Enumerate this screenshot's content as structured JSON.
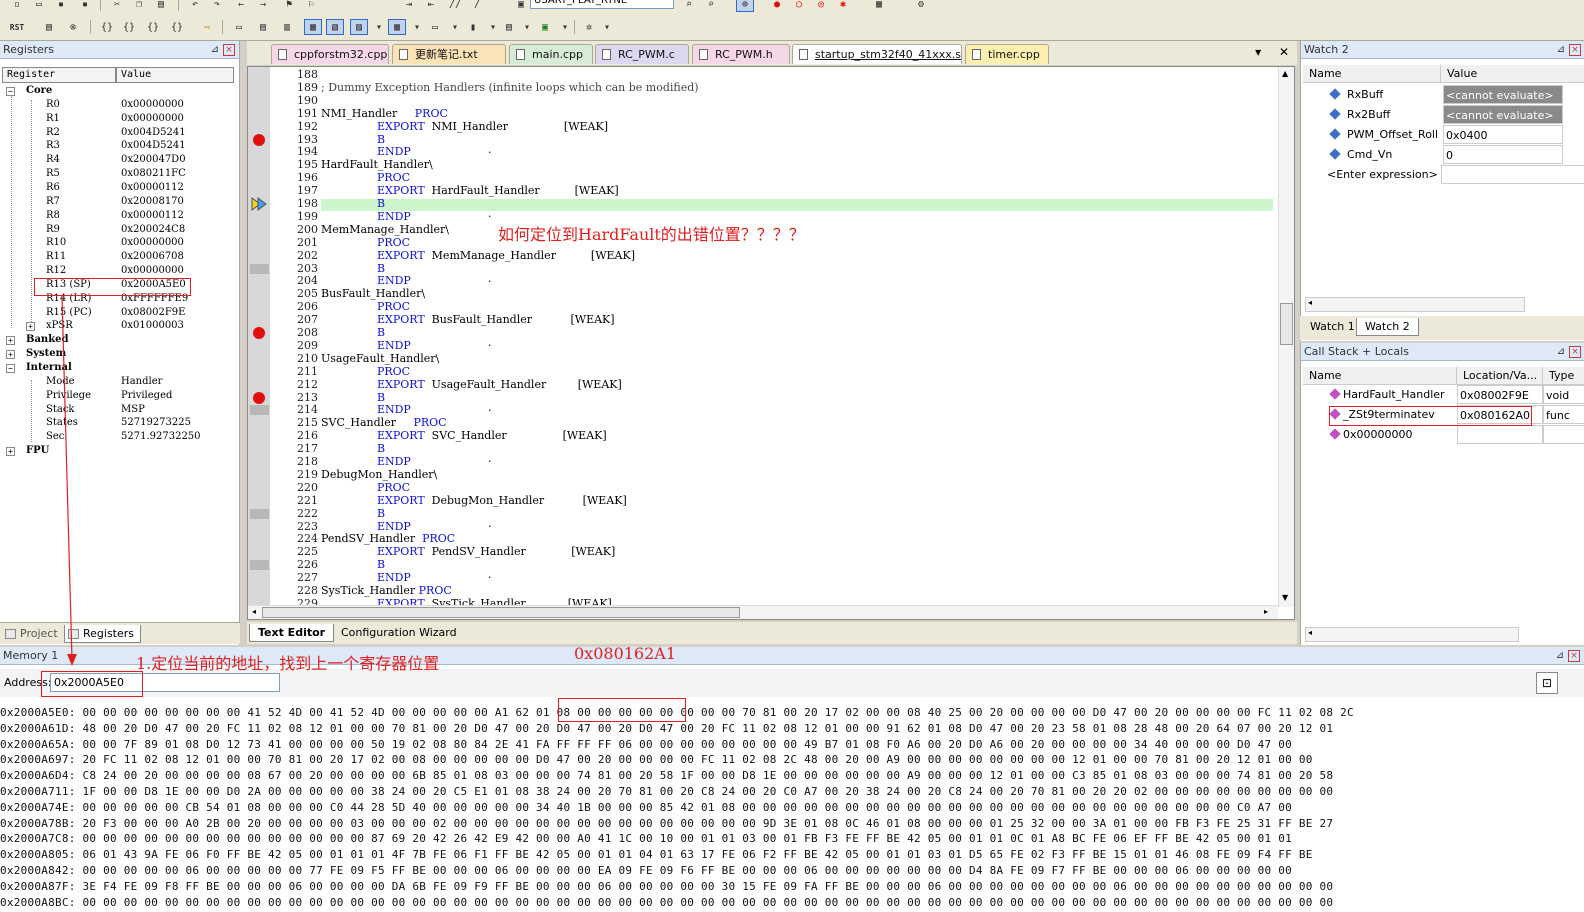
{
  "toolbar": {
    "combo_target": "USART_PLAT_RTNE",
    "rst_label": "RST"
  },
  "registers": {
    "title": "Registers",
    "col_register": "Register",
    "col_value": "Value",
    "rows": [
      {
        "name": "Core",
        "value": "",
        "depth": 0,
        "expand": "−",
        "bold": true
      },
      {
        "name": "R0",
        "value": "0x00000000",
        "depth": 2
      },
      {
        "name": "R1",
        "value": "0x00000000",
        "depth": 2
      },
      {
        "name": "R2",
        "value": "0x004D5241",
        "depth": 2
      },
      {
        "name": "R3",
        "value": "0x004D5241",
        "depth": 2
      },
      {
        "name": "R4",
        "value": "0x200047D0",
        "depth": 2
      },
      {
        "name": "R5",
        "value": "0x080211FC",
        "depth": 2
      },
      {
        "name": "R6",
        "value": "0x00000112",
        "depth": 2
      },
      {
        "name": "R7",
        "value": "0x20008170",
        "depth": 2
      },
      {
        "name": "R8",
        "value": "0x00000112",
        "depth": 2
      },
      {
        "name": "R9",
        "value": "0x200024C8",
        "depth": 2
      },
      {
        "name": "R10",
        "value": "0x00000000",
        "depth": 2
      },
      {
        "name": "R11",
        "value": "0x20006708",
        "depth": 2
      },
      {
        "name": "R12",
        "value": "0x00000000",
        "depth": 2
      },
      {
        "name": "R13 (SP)",
        "value": "0x2000A5E0",
        "depth": 2
      },
      {
        "name": "R14 (LR)",
        "value": "0xFFFFFFE9",
        "depth": 2
      },
      {
        "name": "R15 (PC)",
        "value": "0x08002F9E",
        "depth": 2
      },
      {
        "name": "xPSR",
        "value": "0x01000003",
        "depth": 2,
        "expand": "+"
      },
      {
        "name": "Banked",
        "value": "",
        "depth": 0,
        "expand": "+"
      },
      {
        "name": "System",
        "value": "",
        "depth": 0,
        "expand": "+"
      },
      {
        "name": "Internal",
        "value": "",
        "depth": 0,
        "expand": "−"
      },
      {
        "name": "Mode",
        "value": "Handler",
        "depth": 2
      },
      {
        "name": "Privilege",
        "value": "Privileged",
        "depth": 2
      },
      {
        "name": "Stack",
        "value": "MSP",
        "depth": 2
      },
      {
        "name": "States",
        "value": "52719273225",
        "depth": 2
      },
      {
        "name": "Sec",
        "value": "5271.92732250",
        "depth": 2
      },
      {
        "name": "FPU",
        "value": "",
        "depth": 0,
        "expand": "+"
      }
    ],
    "tab_project": "Project",
    "tab_registers": "Registers"
  },
  "editor": {
    "tabs": [
      {
        "label": "cppforstm32.cpp",
        "color": "#f6d7e6"
      },
      {
        "label": "更新笔记.txt",
        "color": "#fbe3b8"
      },
      {
        "label": "main.cpp",
        "color": "#d7ecd7"
      },
      {
        "label": "RC_PWM.c",
        "color": "#ded7f0"
      },
      {
        "label": "RC_PWM.h",
        "color": "#f6d7e6"
      },
      {
        "label": "startup_stm32f40_41xxx.s",
        "color": "#ffffff"
      },
      {
        "label": "timer.cpp",
        "color": "#fbefb0"
      }
    ],
    "lines": [
      {
        "n": "188",
        "parts": []
      },
      {
        "n": "189",
        "parts": [
          {
            "t": "; Dummy Exception Handlers (infinite loops which can be modified)",
            "c": "cm"
          }
        ]
      },
      {
        "n": "190",
        "parts": []
      },
      {
        "n": "191",
        "parts": [
          {
            "t": "NMI_Handler     "
          },
          {
            "t": "PROC",
            "c": "kw"
          }
        ]
      },
      {
        "n": "192",
        "parts": [
          {
            "t": "                "
          },
          {
            "t": "EXPORT",
            "c": "kw"
          },
          {
            "t": "  NMI_Handler                [WEAK]"
          }
        ]
      },
      {
        "n": "193",
        "parts": [
          {
            "t": "                "
          },
          {
            "t": "B",
            "c": "kw"
          }
        ],
        "next": "."
      },
      {
        "n": "194",
        "parts": [
          {
            "t": "                "
          },
          {
            "t": "ENDP",
            "c": "kw"
          }
        ]
      },
      {
        "n": "195",
        "parts": [
          {
            "t": "HardFault_Handler\\"
          }
        ]
      },
      {
        "n": "196",
        "parts": [
          {
            "t": "                "
          },
          {
            "t": "PROC",
            "c": "kw"
          }
        ]
      },
      {
        "n": "197",
        "parts": [
          {
            "t": "                "
          },
          {
            "t": "EXPORT",
            "c": "kw"
          },
          {
            "t": "  HardFault_Handler          [WEAK]"
          }
        ]
      },
      {
        "n": "198",
        "parts": [
          {
            "t": "                "
          },
          {
            "t": "B",
            "c": "kw"
          }
        ],
        "next": "."
      },
      {
        "n": "199",
        "parts": [
          {
            "t": "                "
          },
          {
            "t": "ENDP",
            "c": "kw"
          }
        ]
      },
      {
        "n": "200",
        "parts": [
          {
            "t": "MemManage_Handler\\"
          }
        ]
      },
      {
        "n": "201",
        "parts": [
          {
            "t": "                "
          },
          {
            "t": "PROC",
            "c": "kw"
          }
        ]
      },
      {
        "n": "202",
        "parts": [
          {
            "t": "                "
          },
          {
            "t": "EXPORT",
            "c": "kw"
          },
          {
            "t": "  MemManage_Handler          [WEAK]"
          }
        ]
      },
      {
        "n": "203",
        "parts": [
          {
            "t": "                "
          },
          {
            "t": "B",
            "c": "kw"
          }
        ],
        "next": "."
      },
      {
        "n": "204",
        "parts": [
          {
            "t": "                "
          },
          {
            "t": "ENDP",
            "c": "kw"
          }
        ]
      },
      {
        "n": "205",
        "parts": [
          {
            "t": "BusFault_Handler\\"
          }
        ]
      },
      {
        "n": "206",
        "parts": [
          {
            "t": "                "
          },
          {
            "t": "PROC",
            "c": "kw"
          }
        ]
      },
      {
        "n": "207",
        "parts": [
          {
            "t": "                "
          },
          {
            "t": "EXPORT",
            "c": "kw"
          },
          {
            "t": "  BusFault_Handler           [WEAK]"
          }
        ]
      },
      {
        "n": "208",
        "parts": [
          {
            "t": "                "
          },
          {
            "t": "B",
            "c": "kw"
          }
        ],
        "next": "."
      },
      {
        "n": "209",
        "parts": [
          {
            "t": "                "
          },
          {
            "t": "ENDP",
            "c": "kw"
          }
        ]
      },
      {
        "n": "210",
        "parts": [
          {
            "t": "UsageFault_Handler\\"
          }
        ]
      },
      {
        "n": "211",
        "parts": [
          {
            "t": "                "
          },
          {
            "t": "PROC",
            "c": "kw"
          }
        ]
      },
      {
        "n": "212",
        "parts": [
          {
            "t": "                "
          },
          {
            "t": "EXPORT",
            "c": "kw"
          },
          {
            "t": "  UsageFault_Handler         [WEAK]"
          }
        ]
      },
      {
        "n": "213",
        "parts": [
          {
            "t": "                "
          },
          {
            "t": "B",
            "c": "kw"
          }
        ],
        "next": "."
      },
      {
        "n": "214",
        "parts": [
          {
            "t": "                "
          },
          {
            "t": "ENDP",
            "c": "kw"
          }
        ]
      },
      {
        "n": "215",
        "parts": [
          {
            "t": "SVC_Handler     "
          },
          {
            "t": "PROC",
            "c": "kw"
          }
        ]
      },
      {
        "n": "216",
        "parts": [
          {
            "t": "                "
          },
          {
            "t": "EXPORT",
            "c": "kw"
          },
          {
            "t": "  SVC_Handler                [WEAK]"
          }
        ]
      },
      {
        "n": "217",
        "parts": [
          {
            "t": "                "
          },
          {
            "t": "B",
            "c": "kw"
          }
        ],
        "next": "."
      },
      {
        "n": "218",
        "parts": [
          {
            "t": "                "
          },
          {
            "t": "ENDP",
            "c": "kw"
          }
        ]
      },
      {
        "n": "219",
        "parts": [
          {
            "t": "DebugMon_Handler\\"
          }
        ]
      },
      {
        "n": "220",
        "parts": [
          {
            "t": "                "
          },
          {
            "t": "PROC",
            "c": "kw"
          }
        ]
      },
      {
        "n": "221",
        "parts": [
          {
            "t": "                "
          },
          {
            "t": "EXPORT",
            "c": "kw"
          },
          {
            "t": "  DebugMon_Handler           [WEAK]"
          }
        ]
      },
      {
        "n": "222",
        "parts": [
          {
            "t": "                "
          },
          {
            "t": "B",
            "c": "kw"
          }
        ],
        "next": "."
      },
      {
        "n": "223",
        "parts": [
          {
            "t": "                "
          },
          {
            "t": "ENDP",
            "c": "kw"
          }
        ]
      },
      {
        "n": "224",
        "parts": [
          {
            "t": "PendSV_Handler  "
          },
          {
            "t": "PROC",
            "c": "kw"
          }
        ]
      },
      {
        "n": "225",
        "parts": [
          {
            "t": "                "
          },
          {
            "t": "EXPORT",
            "c": "kw"
          },
          {
            "t": "  PendSV_Handler             [WEAK]"
          }
        ]
      },
      {
        "n": "226",
        "parts": [
          {
            "t": "                "
          },
          {
            "t": "B",
            "c": "kw"
          }
        ],
        "next": "."
      },
      {
        "n": "227",
        "parts": [
          {
            "t": "                "
          },
          {
            "t": "ENDP",
            "c": "kw"
          }
        ]
      },
      {
        "n": "228",
        "parts": [
          {
            "t": "SysTick_Handler "
          },
          {
            "t": "PROC",
            "c": "kw"
          }
        ]
      },
      {
        "n": "229",
        "parts": [
          {
            "t": "                "
          },
          {
            "t": "EXPORT",
            "c": "kw"
          },
          {
            "t": "  SysTick_Handler            [WEAK]"
          }
        ]
      }
    ],
    "annotation": "如何定位到HardFault的出错位置？？？？",
    "tab_text_editor": "Text Editor",
    "tab_config_wizard": "Configuration Wizard"
  },
  "watch": {
    "title": "Watch 2",
    "col_name": "Name",
    "col_value": "Value",
    "rows": [
      {
        "name": "RxBuff",
        "value": "<cannot evaluate>",
        "dark": true
      },
      {
        "name": "Rx2Buff",
        "value": "<cannot evaluate>",
        "dark": true
      },
      {
        "name": "PWM_Offset_Roll",
        "value": "0x0400"
      },
      {
        "name": "Cmd_Vn",
        "value": "0"
      }
    ],
    "enter_expression": "<Enter expression>",
    "tab1": "Watch 1",
    "tab2": "Watch 2"
  },
  "callstack": {
    "title": "Call Stack + Locals",
    "col_name": "Name",
    "col_location": "Location/Va...",
    "col_type": "Type",
    "rows": [
      {
        "name": "HardFault_Handler",
        "loc": "0x08002F9E",
        "type": "void"
      },
      {
        "name": "_ZSt9terminatev",
        "loc": "0x080162A0",
        "type": "func"
      },
      {
        "name": "0x00000000",
        "loc": "",
        "type": ""
      }
    ]
  },
  "memory": {
    "title": "Memory 1",
    "address_label": "Address:",
    "address_value": "0x2000A5E0",
    "annotation_step": "1.定位当前的地址，找到上一个寄存器位置",
    "annotation_addr": "0x080162A1",
    "lines": [
      "0x2000A5E0: 00 00 00 00 00 00 00 00 41 52 4D 00 41 52 4D 00 00 00 00 00 A1 62 01 08 00 00 00 00 00 00 00 00 70 81 00 20 17 02 00 00 08 40 25 00 20 00 00 00 00 D0 47 00 20 00 00 00 00 FC 11 02 08 2C",
      "0x2000A61D: 48 00 20 D0 47 00 20 FC 11 02 08 12 01 00 00 70 81 00 20 D0 47 00 20 D0 47 00 20 D0 47 00 20 FC 11 02 08 12 01 00 00 91 62 01 08 D0 47 00 20 23 58 01 08 28 48 00 20 64 07 00 20 12 01",
      "0x2000A65A: 00 00 7F 89 01 08 D0 12 73 41 00 00 00 00 50 19 02 08 80 84 2E 41 FA FF FF FF 06 00 00 00 00 00 00 00 00 49 B7 01 08 F0 A6 00 20 D0 A6 00 20 00 00 00 00 34 40 00 00 00 D0 47 00",
      "0x2000A697: 20 FC 11 02 08 12 01 00 00 70 81 00 20 17 02 00 08 00 00 00 00 00 D0 47 00 20 00 00 00 00 FC 11 02 08 2C 48 00 20 00 A9 00 00 00 00 00 00 00 00 12 01 00 00 70 81 00 20 12 01 00 00",
      "0x2000A6D4: C8 24 00 20 00 00 00 00 08 67 00 20 00 00 00 00 6B 85 01 08 03 00 00 00 74 81 00 20 58 1F 00 00 D8 1E 00 00 00 00 00 00 A9 00 00 00 12 01 00 00 C3 85 01 08 03 00 00 00 74 81 00 20 58",
      "0x2000A711: 1F 00 00 D8 1E 00 00 D0 2A 00 00 00 00 00 38 24 00 20 C5 E1 01 08 38 24 00 20 70 81 00 20 C8 24 00 20 C0 A7 00 20 38 24 00 20 C8 24 00 20 70 81 00 20 20 02 00 00 00 00 00 00 00 00 00",
      "0x2000A74E: 00 00 00 00 00 CB 54 01 08 00 00 00 C0 44 28 5D 40 00 00 00 00 00 34 40 1B 00 00 00 85 42 01 08 00 00 00 00 00 00 00 00 00 00 00 00 00 00 00 00 00 00 00 00 00 00 00 00 C0 A7 00",
      "0x2000A78B: 20 F3 00 00 00 A0 2B 00 20 00 00 00 00 03 00 00 00 02 00 00 00 00 00 00 00 00 00 00 00 00 00 00 00 9D 3E 01 08 0C 46 01 08 00 00 00 01 25 32 00 00 3A 01 00 00 FB F3 FE 25 31 FF BE 27",
      "0x2000A7C8: 00 00 00 00 00 00 00 00 00 00 00 00 00 00 87 69 20 42 26 42 E9 42 00 00 A0 41 1C 00 10 00 01 01 03 00 01 FB F3 FE FF BE 42 05 00 01 01 0C 01 A8 BC FE 06 EF FF BE 42 05 00 01 01",
      "0x2000A805: 06 01 43 9A FE 06 F0 FF BE 42 05 00 01 01 01 4F 7B FE 06 F1 FF BE 42 05 00 01 01 04 01 63 17 FE 06 F2 FF BE 42 05 00 01 01 03 01 D5 65 FE 02 F3 FF BE 15 01 01 46 08 FE 09 F4 FF BE",
      "0x2000A842: 00 00 00 00 00 06 00 00 00 00 00 77 FE 09 F5 FF BE 00 00 00 06 00 00 00 00 EA 09 FE 09 F6 FF BE 00 00 00 06 00 00 00 00 00 00 00 D4 8A FE 09 F7 FF BE 00 00 00 06 00 00 00 00 00",
      "0x2000A87F: 3E F4 FE 09 F8 FF BE 00 00 00 06 00 00 00 00 DA 6B FE 09 F9 FF BE 00 00 00 06 00 00 00 00 00 30 15 FE 09 FA FF BE 00 00 00 06 00 00 00 00 00 00 00 00 06 00 00 00 00 00 00 00 00 00 00",
      "0x2000A8BC: 00 00 00 00 00 00 00 00 00 00 00 00 00 00 00 00 00 00 00 00 00 00 00 00 00 00 00 00 00 00 00 00 00 00 00 00 00 00 00 00 00 00 00 00 00 00 00 00 00 00 00 00 00 00 00 00 00 00 00 00 00"
    ]
  }
}
